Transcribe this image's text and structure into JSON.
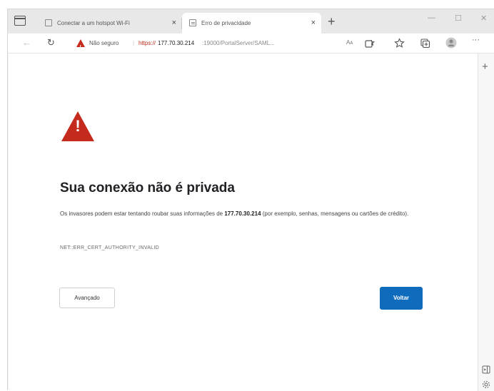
{
  "tabs": [
    {
      "title": "Conectar a um hotspot Wi-Fi",
      "close": "×",
      "active": false
    },
    {
      "title": "Erro de privacidade",
      "close": "×",
      "active": true
    }
  ],
  "new_tab": "+",
  "window_controls": {
    "minimize": "—",
    "maximize": "☐",
    "close": "✕"
  },
  "toolbar": {
    "back": "←",
    "reload": "↻",
    "not_secure": "Não seguro",
    "separator": "|",
    "url_scheme": "https://",
    "url_host": "177.70.30.214",
    "url_path": ":19000/PortalServer/SAML...",
    "read_aloud": "Aᴀ",
    "more": "···"
  },
  "side_rail": {
    "add": "+"
  },
  "error_page": {
    "heading": "Sua conexão não é privada",
    "description_before": "Os invasores podem estar tentando roubar suas informações de ",
    "description_host": "177.70.30.214",
    "description_after": " (por exemplo, senhas, mensagens ou cartões de crédito).",
    "error_code": "NET::ERR_CERT_AUTHORITY_INVALID",
    "advanced_button": "Avançado",
    "back_button": "Voltar",
    "warning_icon_color": "#c42b1c",
    "back_button_color": "#0f6cbd"
  }
}
